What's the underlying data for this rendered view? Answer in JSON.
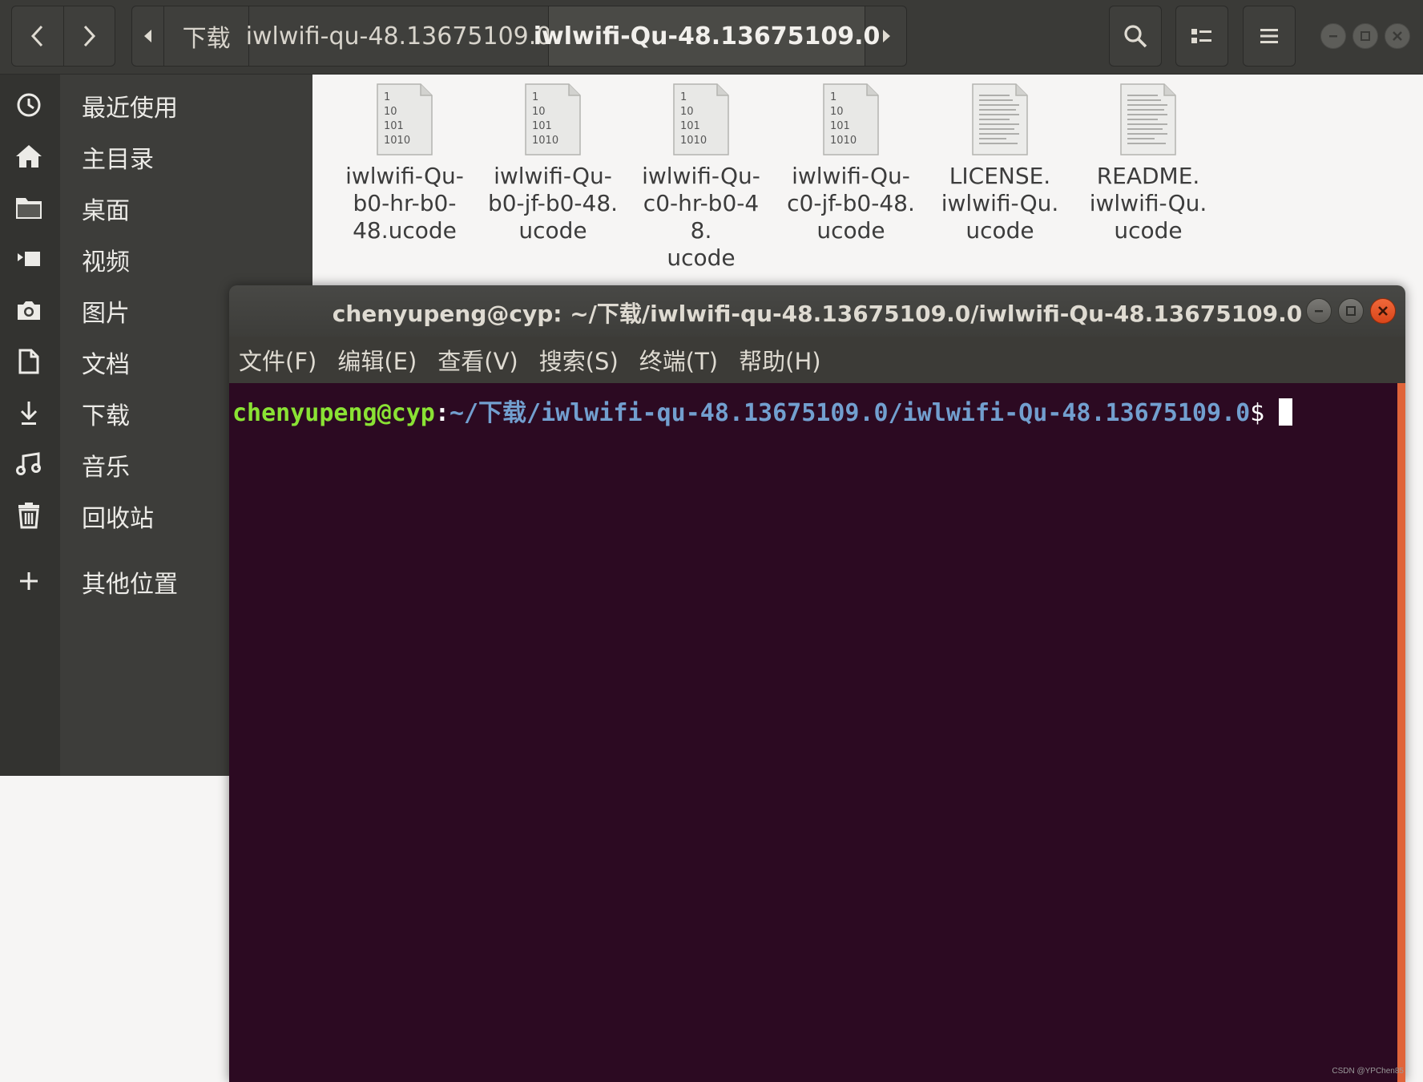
{
  "file_manager": {
    "nav": {
      "back_icon": "chevron-left-icon",
      "forward_icon": "chevron-right-icon"
    },
    "path_segments": [
      {
        "label": "下载"
      },
      {
        "label": "iwlwifi-qu-48.13675109.0"
      },
      {
        "label": "iwlwifi-Qu-48.13675109.0"
      }
    ],
    "sidebar": {
      "items": [
        {
          "label": "最近使用",
          "icon": "clock-icon"
        },
        {
          "label": "主目录",
          "icon": "home-icon"
        },
        {
          "label": "桌面",
          "icon": "folder-icon"
        },
        {
          "label": "视频",
          "icon": "video-icon"
        },
        {
          "label": "图片",
          "icon": "camera-icon"
        },
        {
          "label": "文档",
          "icon": "document-icon"
        },
        {
          "label": "下载",
          "icon": "download-icon"
        },
        {
          "label": "音乐",
          "icon": "music-icon"
        },
        {
          "label": "回收站",
          "icon": "trash-icon"
        },
        {
          "label": "其他位置",
          "icon": "plus-icon"
        }
      ]
    },
    "files": [
      {
        "lines": [
          "iwlwifi-Qu-",
          "b0-hr-b0-",
          "48.ucode"
        ],
        "icon": "binary-file-icon",
        "binary_text": [
          "1",
          "10",
          "101",
          "1010"
        ]
      },
      {
        "lines": [
          "iwlwifi-Qu-",
          "b0-jf-b0-48.",
          "ucode"
        ],
        "icon": "binary-file-icon",
        "binary_text": [
          "1",
          "10",
          "101",
          "1010"
        ]
      },
      {
        "lines": [
          "iwlwifi-Qu-",
          "c0-hr-b0-48.",
          "ucode"
        ],
        "icon": "binary-file-icon",
        "binary_text": [
          "1",
          "10",
          "101",
          "1010"
        ]
      },
      {
        "lines": [
          "iwlwifi-Qu-",
          "c0-jf-b0-48.",
          "ucode"
        ],
        "icon": "binary-file-icon",
        "binary_text": [
          "1",
          "10",
          "101",
          "1010"
        ]
      },
      {
        "lines": [
          "LICENSE.",
          "iwlwifi-Qu.",
          "ucode"
        ],
        "icon": "text-file-icon"
      },
      {
        "lines": [
          "README.",
          "iwlwifi-Qu.",
          "ucode"
        ],
        "icon": "text-file-icon"
      }
    ]
  },
  "terminal": {
    "title": "chenyupeng@cyp: ~/下载/iwlwifi-qu-48.13675109.0/iwlwifi-Qu-48.13675109.0",
    "menu": [
      "文件(F)",
      "编辑(E)",
      "查看(V)",
      "搜索(S)",
      "终端(T)",
      "帮助(H)"
    ],
    "prompt": {
      "user_host": "chenyupeng@cyp",
      "colon": ":",
      "path": "~/下载/iwlwifi-qu-48.13675109.0/iwlwifi-Qu-48.13675109.0",
      "dollar": "$"
    }
  },
  "watermark": "CSDN @YPChen85",
  "colors": {
    "terminal_bg": "#2c0a22",
    "prompt_user": "#8ae234",
    "prompt_path": "#729fcf",
    "close_button": "#e65b2c"
  }
}
